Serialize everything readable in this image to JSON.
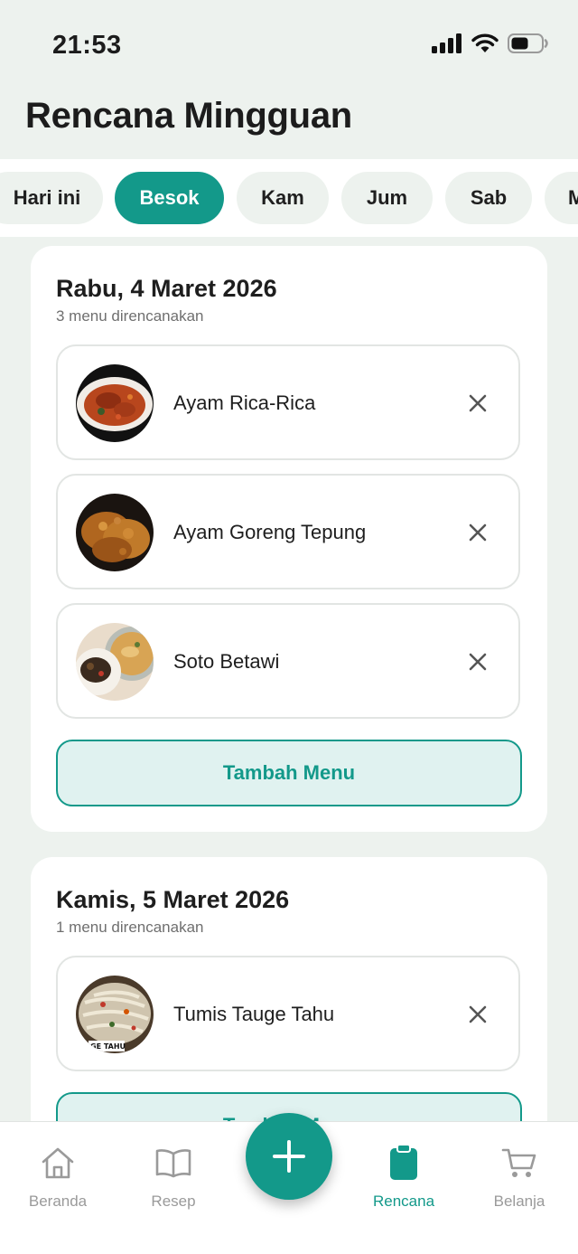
{
  "status_bar": {
    "time": "21:53"
  },
  "header": {
    "title": "Rencana Mingguan"
  },
  "day_tabs": [
    {
      "label": "Hari ini",
      "active": false
    },
    {
      "label": "Besok",
      "active": true
    },
    {
      "label": "Kam",
      "active": false
    },
    {
      "label": "Jum",
      "active": false
    },
    {
      "label": "Sab",
      "active": false
    },
    {
      "label": "M",
      "active": false
    }
  ],
  "days": [
    {
      "date": "Rabu, 4 Maret 2026",
      "count_text": "3 menu direncanakan",
      "meals": [
        {
          "name": "Ayam Rica-Rica"
        },
        {
          "name": "Ayam Goreng Tepung"
        },
        {
          "name": "Soto Betawi"
        }
      ],
      "add_label": "Tambah Menu"
    },
    {
      "date": "Kamis, 5 Maret 2026",
      "count_text": "1 menu direncanakan",
      "meals": [
        {
          "name": "Tumis Tauge Tahu",
          "photo_caption": "GE TAHU"
        }
      ],
      "add_label": "Tambah Menu"
    }
  ],
  "bottom_nav": [
    {
      "label": "Beranda",
      "icon": "home-icon",
      "active": false
    },
    {
      "label": "Resep",
      "icon": "book-icon",
      "active": false
    },
    {
      "label": "Rencana",
      "icon": "clipboard-icon",
      "active": true
    },
    {
      "label": "Belanja",
      "icon": "cart-icon",
      "active": false
    }
  ],
  "colors": {
    "accent": "#13998a",
    "background": "#edf2ee",
    "accent_light": "#e0f2f0"
  }
}
